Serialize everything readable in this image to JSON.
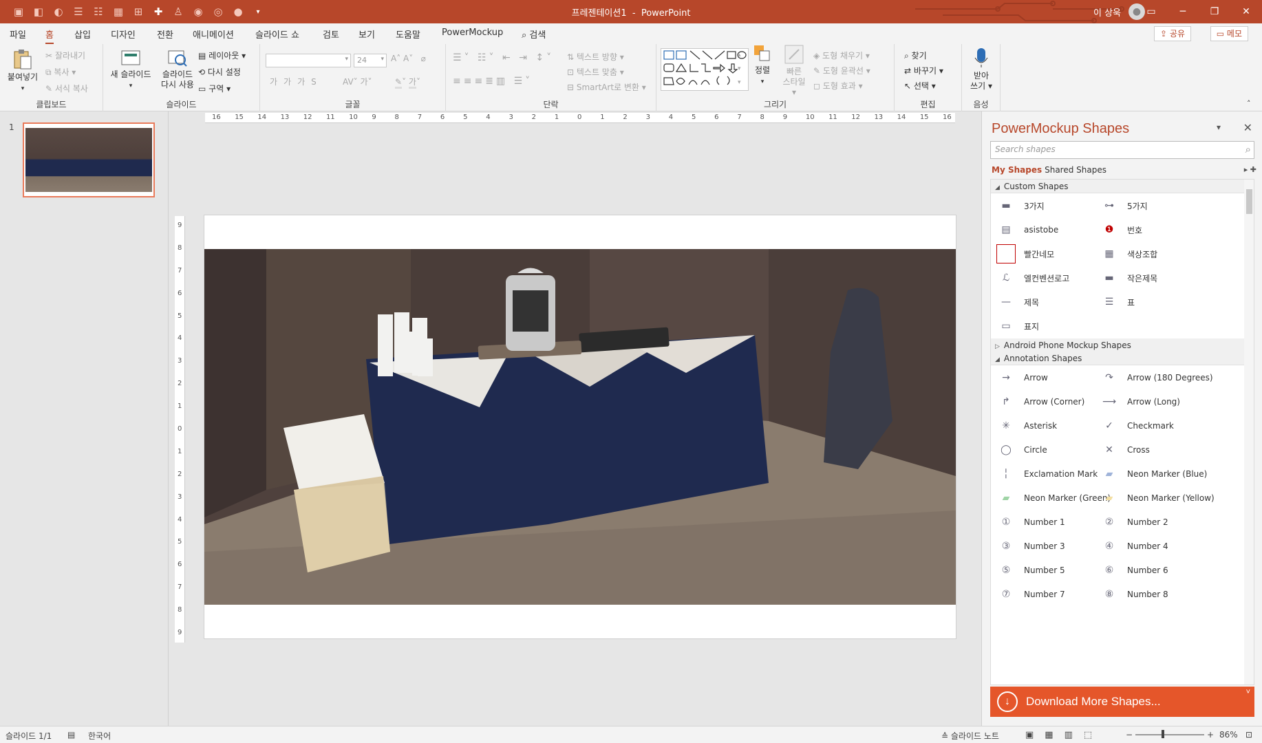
{
  "title": {
    "doc": "프레젠테이션1",
    "sep": "-",
    "app": "PowerPoint",
    "user": "이 상욱"
  },
  "tabs": [
    "파일",
    "홈",
    "삽입",
    "디자인",
    "전환",
    "애니메이션",
    "슬라이드 쇼",
    "검토",
    "보기",
    "도움말",
    "PowerMockup",
    "검색"
  ],
  "share": "공유",
  "memo": "메모",
  "ribbon": {
    "clipboard": {
      "paste": "붙여넣기",
      "cut": "잘라내기",
      "copy": "복사",
      "format": "서식 복사",
      "label": "클립보드"
    },
    "slides": {
      "new": "새 슬라이드",
      "reuse1": "슬라이드",
      "reuse2": "다시 사용",
      "layout": "레이아웃",
      "reset": "다시 설정",
      "section": "구역",
      "label": "슬라이드"
    },
    "font": {
      "size": "24",
      "label": "글꼴"
    },
    "para": {
      "textdir": "텍스트 방향",
      "align": "텍스트 맞춤",
      "smartart": "SmartArt로 변환",
      "label": "단락"
    },
    "draw": {
      "arrange": "정렬",
      "quick1": "빠른",
      "quick2": "스타일",
      "fill": "도형 채우기",
      "outline": "도형 윤곽선",
      "effect": "도형 효과",
      "label": "그리기"
    },
    "edit": {
      "find": "찾기",
      "replace": "바꾸기",
      "select": "선택",
      "label": "편집"
    },
    "voice": {
      "dictate1": "받아",
      "dictate2": "쓰기",
      "label": "음성"
    }
  },
  "thumb_number": "1",
  "ruler_h": [
    "16",
    "15",
    "14",
    "13",
    "12",
    "11",
    "10",
    "9",
    "8",
    "7",
    "6",
    "5",
    "4",
    "3",
    "2",
    "1",
    "0",
    "1",
    "2",
    "3",
    "4",
    "5",
    "6",
    "7",
    "8",
    "9",
    "10",
    "11",
    "12",
    "13",
    "14",
    "15",
    "16"
  ],
  "ruler_v": [
    "9",
    "8",
    "7",
    "6",
    "5",
    "4",
    "3",
    "2",
    "1",
    "0",
    "1",
    "2",
    "3",
    "4",
    "5",
    "6",
    "7",
    "8",
    "9"
  ],
  "pm": {
    "title": "PowerMockup Shapes",
    "search_placeholder": "Search shapes",
    "my_shapes": "My Shapes",
    "shared_shapes": "Shared Shapes",
    "sections": {
      "custom": "Custom Shapes",
      "android": "Android Phone Mockup Shapes",
      "annotation": "Annotation Shapes"
    },
    "custom": [
      "3가지",
      "5가지",
      "asistobe",
      "번호",
      "빨간네모",
      "색상조합",
      "엘컨벤션로고",
      "작은제목",
      "제목",
      "표",
      "표지"
    ],
    "annotation": [
      "Arrow",
      "Arrow (180 Degrees)",
      "Arrow (Corner)",
      "Arrow (Long)",
      "Asterisk",
      "Checkmark",
      "Circle",
      "Cross",
      "Exclamation Mark",
      "Neon Marker (Blue)",
      "Neon Marker (Green)",
      "Neon Marker (Yellow)",
      "Number 1",
      "Number 2",
      "Number 3",
      "Number 4",
      "Number 5",
      "Number 6",
      "Number 7",
      "Number 8"
    ],
    "download": "Download More Shapes..."
  },
  "status": {
    "slide": "슬라이드 1/1",
    "lang": "한국어",
    "notes": "슬라이드 노트",
    "zoom": "86%"
  },
  "colors": {
    "accent": "#b7472a",
    "download": "#e5562a"
  }
}
